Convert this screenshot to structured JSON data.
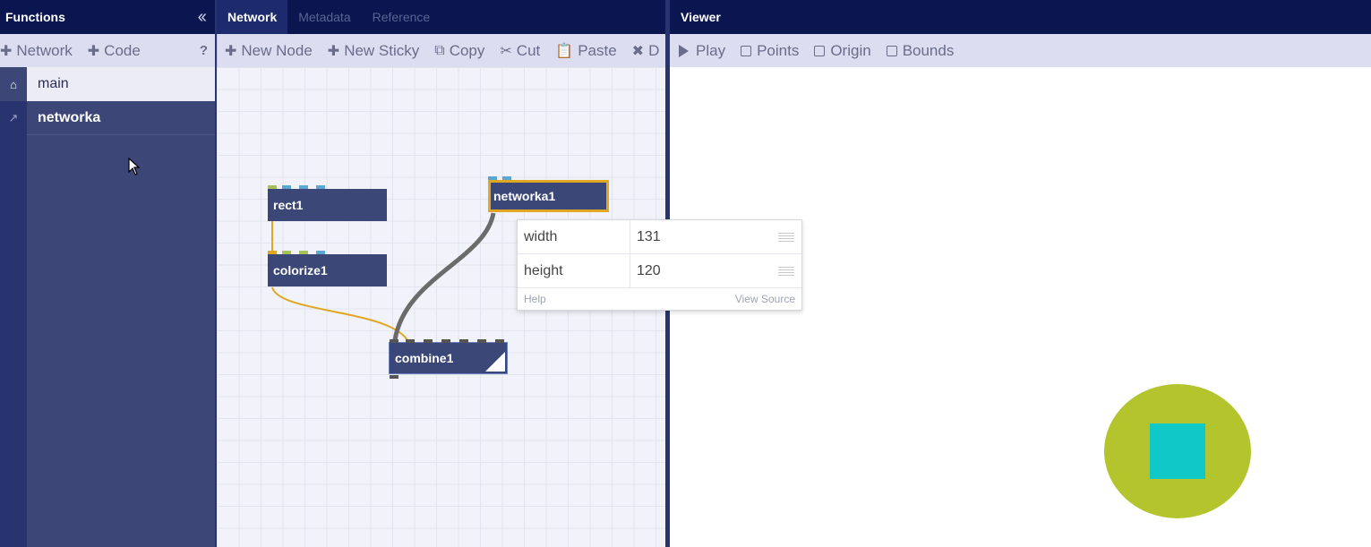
{
  "functions": {
    "title": "Functions",
    "collapse_icon": "double-chevron-left-icon",
    "toolbar": {
      "network_label": "Network",
      "code_label": "Code",
      "help_label": "?"
    },
    "items": [
      {
        "label": "main",
        "icon": "home-icon",
        "active": true
      },
      {
        "label": "networka",
        "icon": "external-link-icon",
        "active": false
      }
    ]
  },
  "network": {
    "tabs": [
      {
        "label": "Network",
        "active": true
      },
      {
        "label": "Metadata",
        "active": false
      },
      {
        "label": "Reference",
        "active": false
      }
    ],
    "toolbar": {
      "new_node": "New Node",
      "new_sticky": "New Sticky",
      "copy": "Copy",
      "cut": "Cut",
      "paste": "Paste",
      "delete": "D"
    },
    "nodes": [
      {
        "id": "rect1",
        "label": "rect1",
        "selected": false
      },
      {
        "id": "colorize1",
        "label": "colorize1",
        "selected": false
      },
      {
        "id": "networka1",
        "label": "networka1",
        "selected": true
      },
      {
        "id": "combine1",
        "label": "combine1",
        "selected": false,
        "rendered": true
      }
    ],
    "connections": [
      {
        "from": "rect1",
        "to": "colorize1",
        "color": "#e0a722"
      },
      {
        "from": "colorize1",
        "to": "combine1",
        "color": "#e0a722"
      },
      {
        "from": "networka1",
        "to": "combine1",
        "color": "#6b6b6b"
      }
    ],
    "colors": {
      "node": "#3b4777",
      "selected_border": "#e0a722",
      "port_green": "#a7c25a",
      "port_blue": "#5ba7cf",
      "port_gray": "#555555"
    }
  },
  "popup": {
    "params": [
      {
        "name": "width",
        "value": "131"
      },
      {
        "name": "height",
        "value": "120"
      }
    ],
    "help_label": "Help",
    "view_source_label": "View Source"
  },
  "viewer": {
    "title": "Viewer",
    "toolbar": {
      "play": "Play",
      "points": "Points",
      "origin": "Origin",
      "bounds": "Bounds"
    },
    "colors": {
      "ellipse": "#b3c42c",
      "square": "#11c8c9"
    }
  }
}
